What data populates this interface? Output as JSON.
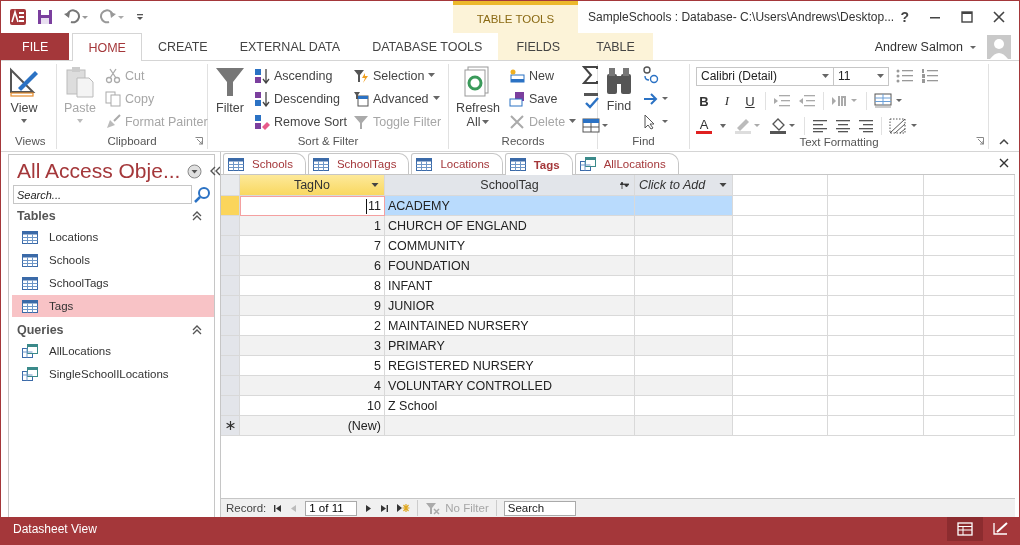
{
  "window": {
    "title": "SampleSchools : Database- C:\\Users\\Andrews\\Desktop...",
    "help": "?"
  },
  "contextual_group": "TABLE TOOLS",
  "ribbon_tabs": [
    {
      "label": "FILE",
      "kind": "file",
      "selected": false
    },
    {
      "label": "HOME",
      "kind": "main",
      "selected": true
    },
    {
      "label": "CREATE",
      "kind": "main",
      "selected": false
    },
    {
      "label": "EXTERNAL DATA",
      "kind": "main",
      "selected": false
    },
    {
      "label": "DATABASE TOOLS",
      "kind": "main",
      "selected": false
    },
    {
      "label": "FIELDS",
      "kind": "contextual",
      "selected": false
    },
    {
      "label": "TABLE",
      "kind": "contextual",
      "selected": false
    }
  ],
  "user": {
    "name": "Andrew Salmon"
  },
  "ribbon_groups": [
    {
      "title": "Views",
      "commands": [
        {
          "label": "View",
          "disabled": false
        }
      ]
    },
    {
      "title": "Clipboard",
      "commands": [
        {
          "label": "Paste",
          "disabled": true
        },
        {
          "label": "Cut",
          "disabled": true
        },
        {
          "label": "Copy",
          "disabled": true
        },
        {
          "label": "Format Painter",
          "disabled": true
        }
      ]
    },
    {
      "title": "Sort & Filter",
      "commands": [
        {
          "label": "Filter",
          "disabled": false
        },
        {
          "label": "Ascending",
          "disabled": false
        },
        {
          "label": "Descending",
          "disabled": false
        },
        {
          "label": "Remove Sort",
          "disabled": false
        },
        {
          "label": "Selection",
          "disabled": false
        },
        {
          "label": "Advanced",
          "disabled": false
        },
        {
          "label": "Toggle Filter",
          "disabled": true
        }
      ]
    },
    {
      "title": "Records",
      "commands": [
        {
          "label": "Refresh All",
          "disabled": false
        },
        {
          "label": "New",
          "disabled": false
        },
        {
          "label": "Save",
          "disabled": false
        },
        {
          "label": "Delete",
          "disabled": true
        }
      ]
    },
    {
      "title": "Find",
      "commands": [
        {
          "label": "Find",
          "disabled": false
        }
      ]
    },
    {
      "title": "Text Formatting",
      "font": "Calibri (Detail)",
      "size": "11",
      "commands": [
        {
          "label": "B",
          "disabled": false
        },
        {
          "label": "I",
          "disabled": false
        },
        {
          "label": "U",
          "disabled": false
        },
        {
          "label": "A",
          "disabled": false
        }
      ]
    }
  ],
  "nav_pane": {
    "title": "All Access Obje...",
    "search": {
      "placeholder": "Search..."
    },
    "groups": [
      {
        "label": "Tables",
        "expanded": true,
        "items": [
          {
            "label": "Locations",
            "kind": "table",
            "selected": false
          },
          {
            "label": "Schools",
            "kind": "table",
            "selected": false
          },
          {
            "label": "SchoolTags",
            "kind": "table",
            "selected": false
          },
          {
            "label": "Tags",
            "kind": "table",
            "selected": true
          }
        ]
      },
      {
        "label": "Queries",
        "expanded": true,
        "items": [
          {
            "label": "AllLocations",
            "kind": "query",
            "selected": false
          },
          {
            "label": "SingleSchoolILocations",
            "kind": "query",
            "selected": false
          }
        ]
      }
    ]
  },
  "document_tabs": [
    {
      "label": "Schools",
      "kind": "table",
      "selected": false
    },
    {
      "label": "SchoolTags",
      "kind": "table",
      "selected": false
    },
    {
      "label": "Locations",
      "kind": "table",
      "selected": false
    },
    {
      "label": "Tags",
      "kind": "table",
      "selected": true
    },
    {
      "label": "AllLocations",
      "kind": "query",
      "selected": false
    }
  ],
  "datasheet": {
    "columns": [
      {
        "label": "TagNo",
        "kind": "field",
        "selected": true,
        "sorted": false
      },
      {
        "label": "SchoolTag",
        "kind": "field",
        "selected": false,
        "sorted": true
      },
      {
        "label": "Click to Add",
        "kind": "add",
        "selected": false,
        "sorted": false
      }
    ],
    "rows": [
      {
        "tag_no": "11",
        "school_tag": "ACADEMY",
        "selected": true
      },
      {
        "tag_no": "1",
        "school_tag": "CHURCH OF ENGLAND",
        "selected": false
      },
      {
        "tag_no": "7",
        "school_tag": "COMMUNITY",
        "selected": false
      },
      {
        "tag_no": "6",
        "school_tag": "FOUNDATION",
        "selected": false
      },
      {
        "tag_no": "8",
        "school_tag": "INFANT",
        "selected": false
      },
      {
        "tag_no": "9",
        "school_tag": "JUNIOR",
        "selected": false
      },
      {
        "tag_no": "2",
        "school_tag": "MAINTAINED NURSERY",
        "selected": false
      },
      {
        "tag_no": "3",
        "school_tag": "PRIMARY",
        "selected": false
      },
      {
        "tag_no": "5",
        "school_tag": "REGISTERED NURSERY",
        "selected": false
      },
      {
        "tag_no": "4",
        "school_tag": "VOLUNTARY CONTROLLED",
        "selected": false
      },
      {
        "tag_no": "10",
        "school_tag": "Z School",
        "selected": false
      }
    ],
    "new_row": {
      "label": "(New)"
    }
  },
  "record_navigator": {
    "label": "Record:",
    "position": "1 of 11",
    "filter": {
      "label": "No Filter",
      "disabled": true
    },
    "search": {
      "placeholder": "Search"
    }
  },
  "status_bar": {
    "text": "Datasheet View",
    "views": [
      {
        "kind": "datasheet",
        "selected": true
      },
      {
        "kind": "design",
        "selected": false
      }
    ]
  }
}
